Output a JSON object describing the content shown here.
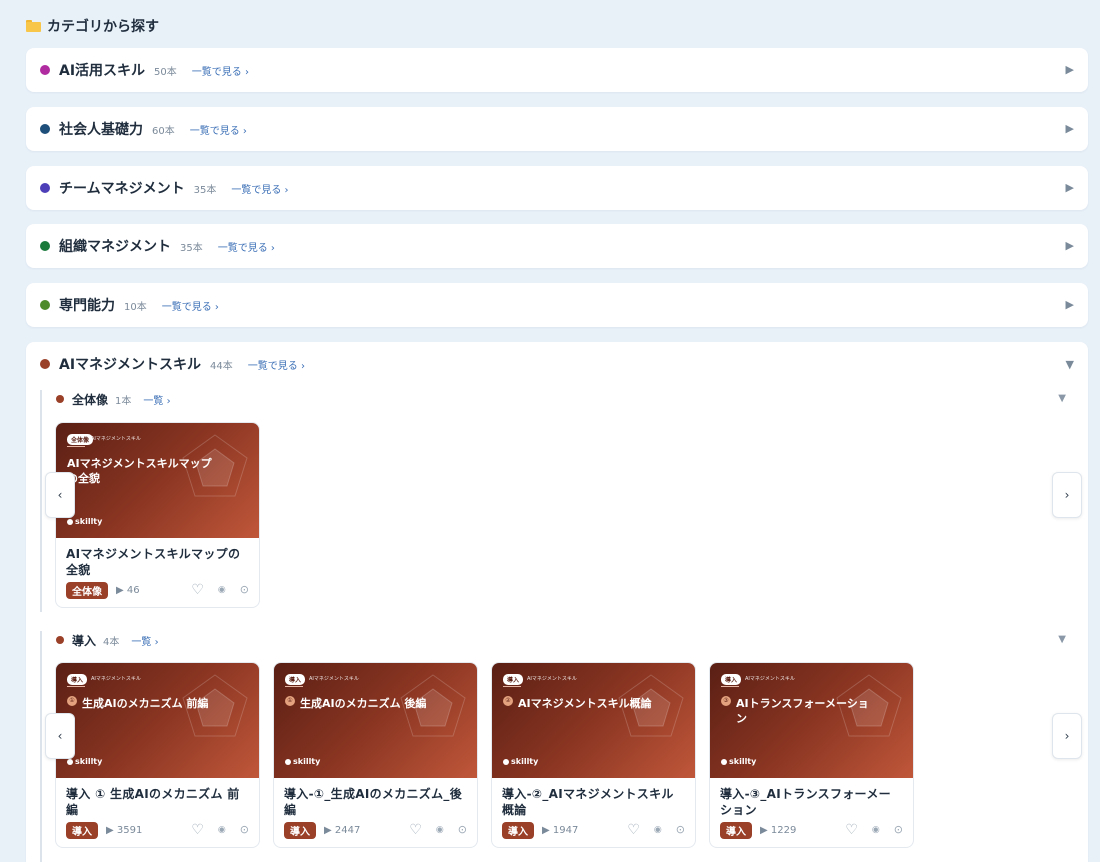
{
  "section": {
    "title": "カテゴリから探す",
    "icon": "folder-icon"
  },
  "categories": [
    {
      "name": "AI活用スキル",
      "count": "50本",
      "link": "一覧で見る ›",
      "color": "#b02aa0"
    },
    {
      "name": "社会人基礎力",
      "count": "60本",
      "link": "一覧で見る ›",
      "color": "#1e4f7a"
    },
    {
      "name": "チームマネジメント",
      "count": "35本",
      "link": "一覧で見る ›",
      "color": "#4d3fb8"
    },
    {
      "name": "組織マネジメント",
      "count": "35本",
      "link": "一覧で見る ›",
      "color": "#1a7a3c"
    },
    {
      "name": "専門能力",
      "count": "10本",
      "link": "一覧で見る ›",
      "color": "#4f8a2a"
    }
  ],
  "collapsed_arrow": "▶",
  "expanded_arrow": "▼",
  "expanded": {
    "name": "AIマネジメントスキル",
    "count": "44本",
    "link": "一覧で見る ›",
    "color": "#9a3f28",
    "subcategories": [
      {
        "name": "全体像",
        "count": "1本",
        "link": "一覧 ›",
        "cards": [
          {
            "thumb_tag": "全体像",
            "thumb_subtitle": "AIマネジメントスキル",
            "thumb_title": "AIマネジメントスキルマップの全貌",
            "logo": "skillty",
            "title": "AIマネジメントスキルマップの全貌",
            "badge": "全体像",
            "plays": "▶ 46"
          }
        ]
      },
      {
        "name": "導入",
        "count": "4本",
        "link": "一覧 ›",
        "cards": [
          {
            "thumb_tag": "導入",
            "thumb_subtitle": "AIマネジメントスキル",
            "thumb_num": "①",
            "thumb_title": "生成AIのメカニズム 前編",
            "logo": "skillty",
            "title": "導入 ① 生成AIのメカニズム 前編",
            "badge": "導入",
            "plays": "▶ 3591"
          },
          {
            "thumb_tag": "導入",
            "thumb_subtitle": "AIマネジメントスキル",
            "thumb_num": "①",
            "thumb_title": "生成AIのメカニズム 後編",
            "logo": "skillty",
            "title": "導入-①_生成AIのメカニズム_後編",
            "badge": "導入",
            "plays": "▶ 2447"
          },
          {
            "thumb_tag": "導入",
            "thumb_subtitle": "AIマネジメントスキル",
            "thumb_num": "②",
            "thumb_title": "AIマネジメントスキル概論",
            "logo": "skillty",
            "title": "導入-②_AIマネジメントスキル概論",
            "badge": "導入",
            "plays": "▶ 1947"
          },
          {
            "thumb_tag": "導入",
            "thumb_subtitle": "AIマネジメントスキル",
            "thumb_num": "③",
            "thumb_title": "AIトランスフォーメーション",
            "logo": "skillty",
            "title": "導入-③_AIトランスフォーメーション",
            "badge": "導入",
            "plays": "▶ 1229"
          }
        ]
      }
    ]
  },
  "card_icons": {
    "like": "♡",
    "view": "👁",
    "more": "⊙"
  },
  "nav": {
    "prev": "‹",
    "next": "›"
  }
}
